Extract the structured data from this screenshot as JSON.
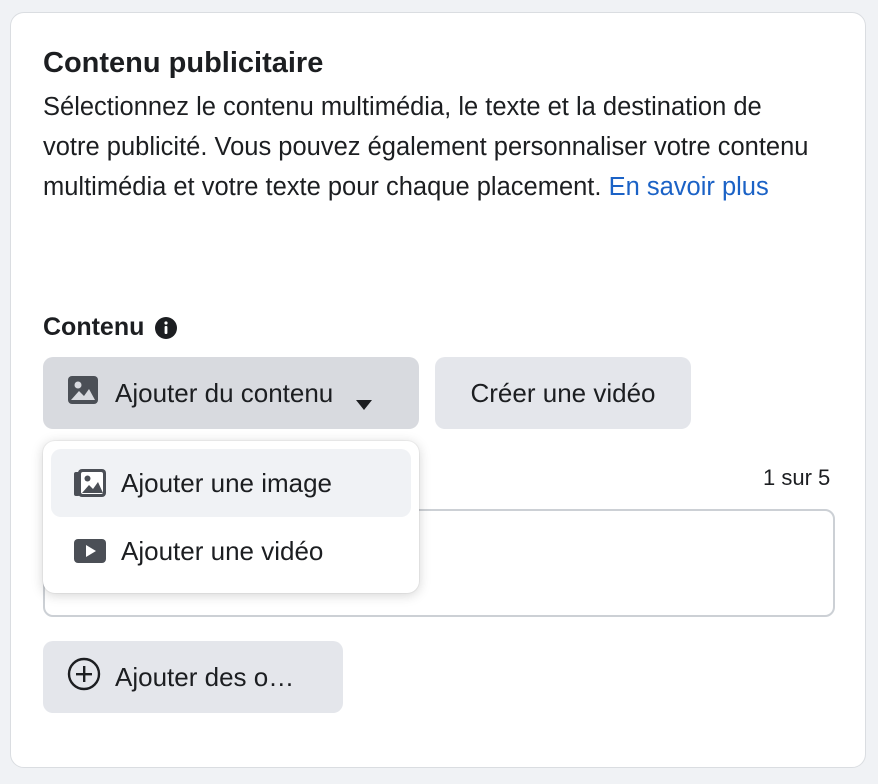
{
  "section": {
    "title": "Contenu publicitaire",
    "description": "Sélectionnez le contenu multimédia, le texte et la destination de votre publicité. Vous pouvez également personnaliser votre contenu multimédia et votre texte pour chaque placement. ",
    "learn_more": "En savoir plus"
  },
  "content": {
    "label": "Contenu",
    "info_icon": "info-icon",
    "add_content_button": "Ajouter du contenu",
    "create_video_button": "Créer une vidéo",
    "counter": "1 sur 5",
    "add_options_button": "Ajouter des o…"
  },
  "dropdown": {
    "items": [
      {
        "label": "Ajouter une image",
        "icon": "image-stack-icon",
        "highlighted": true
      },
      {
        "label": "Ajouter une vidéo",
        "icon": "video-play-icon",
        "highlighted": false
      }
    ]
  },
  "colors": {
    "link": "#1b62c6",
    "button_bg": "#e4e6eb",
    "button_active_bg": "#d8dadf",
    "text": "#1c1e21"
  }
}
